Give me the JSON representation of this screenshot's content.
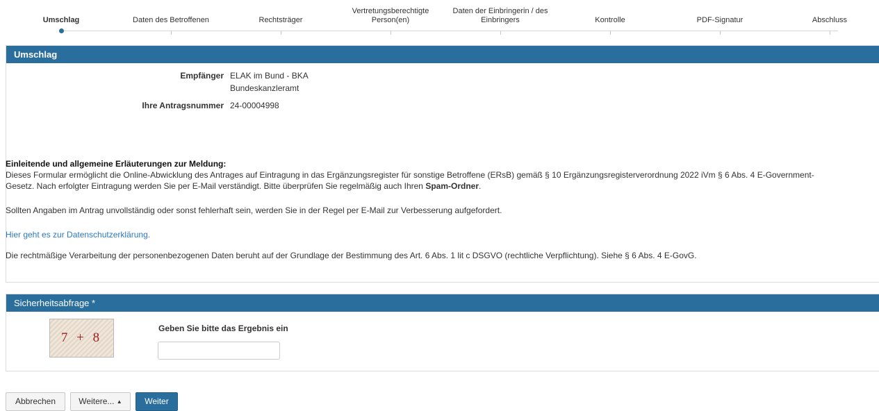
{
  "steps": [
    {
      "label": "Umschlag",
      "active": true
    },
    {
      "label": "Daten des Betroffenen"
    },
    {
      "label": "Rechtsträger"
    },
    {
      "label_lines": [
        "Vertretungsberechtigte",
        "Person(en)"
      ]
    },
    {
      "label_lines": [
        "Daten der Einbringerin / des",
        "Einbringers"
      ]
    },
    {
      "label": "Kontrolle"
    },
    {
      "label": "PDF-Signatur"
    },
    {
      "label": "Abschluss"
    }
  ],
  "umschlag": {
    "title": "Umschlag",
    "empfaenger_label": "Empfänger",
    "empfaenger_line1": "ELAK im Bund - BKA",
    "empfaenger_line2": "Bundeskanzleramt",
    "antragsnummer_label": "Ihre Antragsnummer",
    "antragsnummer_value": "24-00004998",
    "intro_heading": "Einleitende und allgemeine Erläuterungen zur Meldung:",
    "intro_line1": "Dieses Formular ermöglicht die Online-Abwicklung des Antrages auf Eintragung in das Ergänzungsregister für sonstige Betroffene (ERsB) gemäß § 10 Ergänzungsregisterverordnung 2022 iVm § 6 Abs. 4 E-Government-",
    "intro_line2_prefix": "Gesetz. Nach erfolgter Eintragung werden Sie per E-Mail verständigt. Bitte überprüfen Sie regelmäßig auch Ihren ",
    "intro_line2_bold": "Spam-Ordner",
    "intro_line2_suffix": ".",
    "fehler_text": "Sollten Angaben im Antrag unvollständig oder sonst fehlerhaft sein, werden Sie in der Regel per E-Mail zur Verbesserung aufgefordert.",
    "datenschutz_link": "Hier geht es zur Datenschutzerklärung.",
    "rechtsgrundlage_text": "Die rechtmäßige Verarbeitung der personenbezogenen Daten beruht auf der Grundlage der Bestimmung des Art. 6 Abs. 1 lit c DSGVO (rechtliche Verpflichtung). Siehe § 6 Abs. 4 E-GovG."
  },
  "sicherheit": {
    "title": "Sicherheitsabfrage *",
    "captcha_text": "7 + 8",
    "prompt": "Geben Sie bitte das Ergebnis ein",
    "input_value": ""
  },
  "buttons": {
    "abbrechen": "Abbrechen",
    "weitere": "Weitere...",
    "weitere_caret": "▲",
    "weiter": "Weiter"
  },
  "colors": {
    "accent": "#2a6e9e",
    "link": "#2e79c0",
    "captcha_text": "#a02020"
  }
}
